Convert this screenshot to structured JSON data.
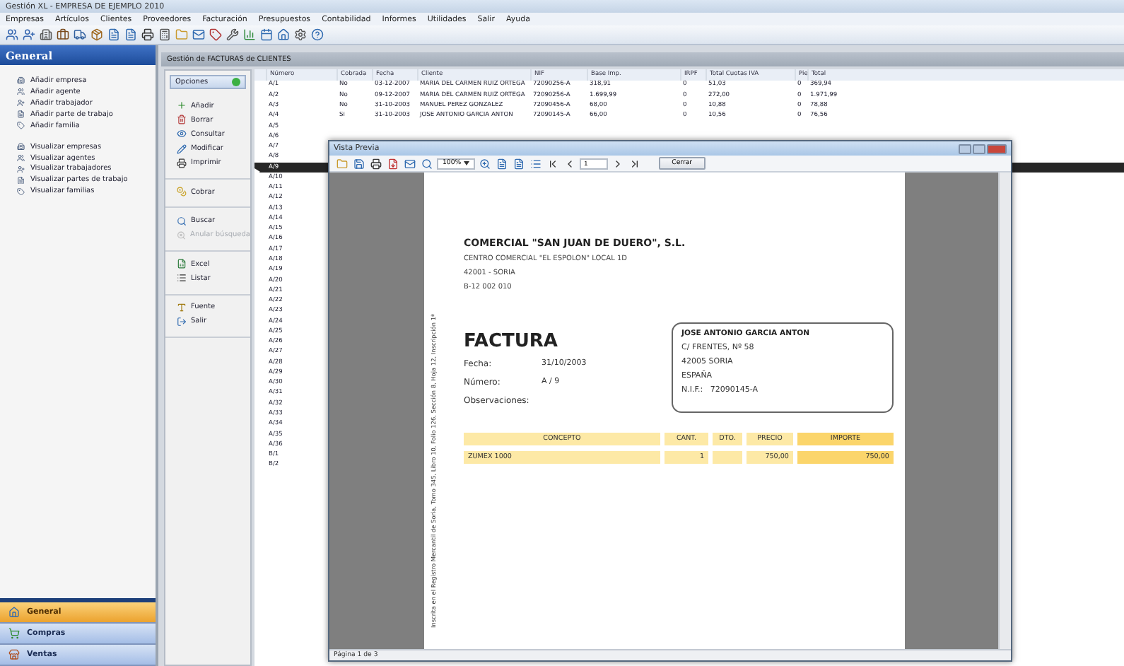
{
  "window": {
    "title": "Gestión XL - EMPRESA DE EJEMPLO 2010"
  },
  "menu": [
    "Empresas",
    "Artículos",
    "Clientes",
    "Proveedores",
    "Facturación",
    "Presupuestos",
    "Contabilidad",
    "Informes",
    "Utilidades",
    "Salir",
    "Ayuda"
  ],
  "sidebar": {
    "title": "General",
    "sections": [
      {
        "items": [
          "Añadir empresa",
          "Añadir agente",
          "Añadir trabajador",
          "Añadir parte de trabajo",
          "Añadir familia"
        ]
      },
      {
        "items": [
          "Visualizar empresas",
          "Visualizar agentes",
          "Visualizar trabajadores",
          "Visualizar partes de trabajo",
          "Visualizar familias"
        ]
      }
    ],
    "nav": [
      {
        "label": "General",
        "selected": true
      },
      {
        "label": "Compras",
        "selected": false
      },
      {
        "label": "Ventas",
        "selected": false
      }
    ]
  },
  "panel": {
    "title": "Gestión de FACTURAS de CLIENTES"
  },
  "options": {
    "title": "Opciones",
    "groups": [
      [
        {
          "label": "Añadir",
          "disabled": false
        },
        {
          "label": "Borrar",
          "disabled": false
        },
        {
          "label": "Consultar",
          "disabled": false
        },
        {
          "label": "Modificar",
          "disabled": false
        },
        {
          "label": "Imprimir",
          "disabled": false
        }
      ],
      [
        {
          "label": "Cobrar",
          "disabled": false
        }
      ],
      [
        {
          "label": "Buscar",
          "disabled": false
        },
        {
          "label": "Anular búsqueda",
          "disabled": true
        }
      ],
      [
        {
          "label": "Excel",
          "disabled": false
        },
        {
          "label": "Listar",
          "disabled": false
        }
      ],
      [
        {
          "label": "Fuente",
          "disabled": false
        },
        {
          "label": "Salir",
          "disabled": false
        }
      ]
    ]
  },
  "table": {
    "columns": [
      "Número",
      "Cobrada",
      "Fecha",
      "Cliente",
      "NIF",
      "Base Imp.",
      "IRPF",
      "Total Cuotas IVA",
      "Pie",
      "Total"
    ],
    "rows": [
      {
        "selected": false,
        "cells": [
          "A/1",
          "No",
          "03-12-2007",
          "MARIA DEL CARMEN RUIZ ORTEGA",
          "72090256-A",
          "318,91",
          "0",
          "51,03",
          "0",
          "369,94"
        ]
      },
      {
        "selected": false,
        "cells": [
          "A/2",
          "No",
          "09-12-2007",
          "MARIA DEL CARMEN RUIZ ORTEGA",
          "72090256-A",
          "1.699,99",
          "0",
          "272,00",
          "0",
          "1.971,99"
        ]
      },
      {
        "selected": false,
        "cells": [
          "A/3",
          "No",
          "31-10-2003",
          "MANUEL PEREZ GONZALEZ",
          "72090456-A",
          "68,00",
          "0",
          "10,88",
          "0",
          "78,88"
        ]
      },
      {
        "selected": false,
        "cells": [
          "A/4",
          "Sí",
          "31-10-2003",
          "JOSE ANTONIO GARCIA ANTON",
          "72090145-A",
          "66,00",
          "0",
          "10,56",
          "0",
          "76,56"
        ]
      },
      {
        "selected": false,
        "cells": [
          "A/5"
        ]
      },
      {
        "selected": false,
        "cells": [
          "A/6"
        ]
      },
      {
        "selected": false,
        "cells": [
          "A/7"
        ]
      },
      {
        "selected": false,
        "cells": [
          "A/8"
        ]
      },
      {
        "selected": true,
        "cells": [
          "A/9"
        ]
      },
      {
        "selected": false,
        "cells": [
          "A/10"
        ]
      },
      {
        "selected": false,
        "cells": [
          "A/11"
        ]
      },
      {
        "selected": false,
        "cells": [
          "A/12"
        ]
      },
      {
        "selected": false,
        "cells": [
          "A/13"
        ]
      },
      {
        "selected": false,
        "cells": [
          "A/14"
        ]
      },
      {
        "selected": false,
        "cells": [
          "A/15"
        ]
      },
      {
        "selected": false,
        "cells": [
          "A/16"
        ]
      },
      {
        "selected": false,
        "cells": [
          "A/17"
        ]
      },
      {
        "selected": false,
        "cells": [
          "A/18"
        ]
      },
      {
        "selected": false,
        "cells": [
          "A/19"
        ]
      },
      {
        "selected": false,
        "cells": [
          "A/20"
        ]
      },
      {
        "selected": false,
        "cells": [
          "A/21"
        ]
      },
      {
        "selected": false,
        "cells": [
          "A/22"
        ]
      },
      {
        "selected": false,
        "cells": [
          "A/23"
        ]
      },
      {
        "selected": false,
        "cells": [
          "A/24"
        ]
      },
      {
        "selected": false,
        "cells": [
          "A/25"
        ]
      },
      {
        "selected": false,
        "cells": [
          "A/26"
        ]
      },
      {
        "selected": false,
        "cells": [
          "A/27"
        ]
      },
      {
        "selected": false,
        "cells": [
          "A/28"
        ]
      },
      {
        "selected": false,
        "cells": [
          "A/29"
        ]
      },
      {
        "selected": false,
        "cells": [
          "A/30"
        ]
      },
      {
        "selected": false,
        "cells": [
          "A/31"
        ]
      },
      {
        "selected": false,
        "cells": [
          "A/32"
        ]
      },
      {
        "selected": false,
        "cells": [
          "A/33"
        ]
      },
      {
        "selected": false,
        "cells": [
          "A/34"
        ]
      },
      {
        "selected": false,
        "cells": [
          "A/35"
        ]
      },
      {
        "selected": false,
        "cells": [
          "A/36"
        ]
      },
      {
        "selected": false,
        "cells": [
          "B/1"
        ]
      },
      {
        "selected": false,
        "cells": [
          "B/2"
        ]
      }
    ]
  },
  "preview": {
    "title": "Vista Previa",
    "zoom": "100%",
    "page": "1",
    "close_button": "Cerrar",
    "status": "Página 1 de 3",
    "document": {
      "company": "COMERCIAL \"SAN JUAN DE DUERO\", S.L.",
      "company_lines": [
        "CENTRO COMERCIAL \"EL ESPOLON\" LOCAL 1D",
        "42001 - SORIA",
        "B-12 002 010"
      ],
      "heading": "FACTURA",
      "fields": [
        {
          "label": "Fecha:",
          "value": "31/10/2003"
        },
        {
          "label": "Número:",
          "value": "A / 9"
        },
        {
          "label": "Observaciones:"
        }
      ],
      "client": {
        "name": "JOSE ANTONIO GARCIA ANTON",
        "lines": [
          "C/ FRENTES, Nº 58",
          "42005    SORIA",
          "ESPAÑA"
        ],
        "nif_label": "N.I.F.:",
        "nif": "72090145-A"
      },
      "margin_note": "Inscrita en el Registro Mercantil de Soria, Tomo 345, Libro 10, Folio 126, Sección 8, Hoja 12, Inscripción 1ª",
      "columns": [
        "CONCEPTO",
        "CANT.",
        "DTO.",
        "PRECIO",
        "IMPORTE"
      ],
      "lines": [
        {
          "concept": "ZUMEX 1000",
          "quantity": "1",
          "price": "750,00",
          "amount": "750,00"
        }
      ]
    }
  }
}
